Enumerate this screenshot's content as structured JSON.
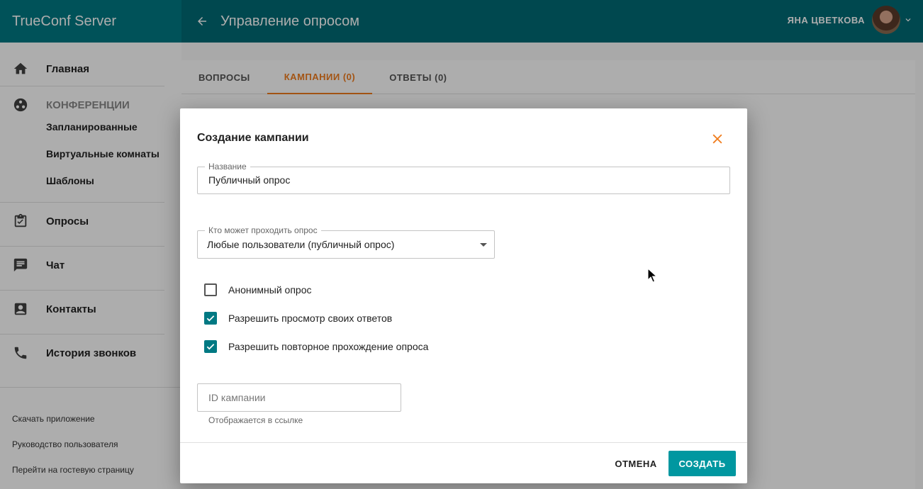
{
  "app": {
    "title": "TrueConf Server"
  },
  "header": {
    "title": "Управление опросом",
    "user_name": "ЯНА ЦВЕТКОВА"
  },
  "sidebar": {
    "home": "Главная",
    "conferences": "КОНФЕРЕНЦИИ",
    "conf_items": [
      "Запланированные",
      "Виртуальные комнаты",
      "Шаблоны"
    ],
    "polls": "Опросы",
    "chat": "Чат",
    "contacts": "Контакты",
    "call_history": "История звонков",
    "footer_links": [
      "Скачать приложение",
      "Руководство пользователя",
      "Перейти на гостевую страницу"
    ]
  },
  "tabs": [
    {
      "label": "ВОПРОСЫ",
      "active": false
    },
    {
      "label": "КАМПАНИИ (0)",
      "active": true
    },
    {
      "label": "ОТВЕТЫ (0)",
      "active": false
    }
  ],
  "dialog": {
    "title": "Создание кампании",
    "name_label": "Название",
    "name_value": "Публичный опрос",
    "who_label": "Кто может проходить опрос",
    "who_value": "Любые пользователи (публичный опрос)",
    "checkboxes": [
      {
        "label": "Анонимный опрос",
        "checked": false
      },
      {
        "label": "Разрешить просмотр своих ответов",
        "checked": true
      },
      {
        "label": "Разрешить повторное прохождение опроса",
        "checked": true
      }
    ],
    "campaign_id_placeholder": "ID кампании",
    "campaign_id_hint": "Отображается в ссылке",
    "cancel": "ОТМЕНА",
    "create": "СОЗДАТЬ"
  },
  "colors": {
    "accent": "#f07d1e",
    "primary": "#007983",
    "topbar": "#006b75",
    "button": "#0097a0"
  }
}
